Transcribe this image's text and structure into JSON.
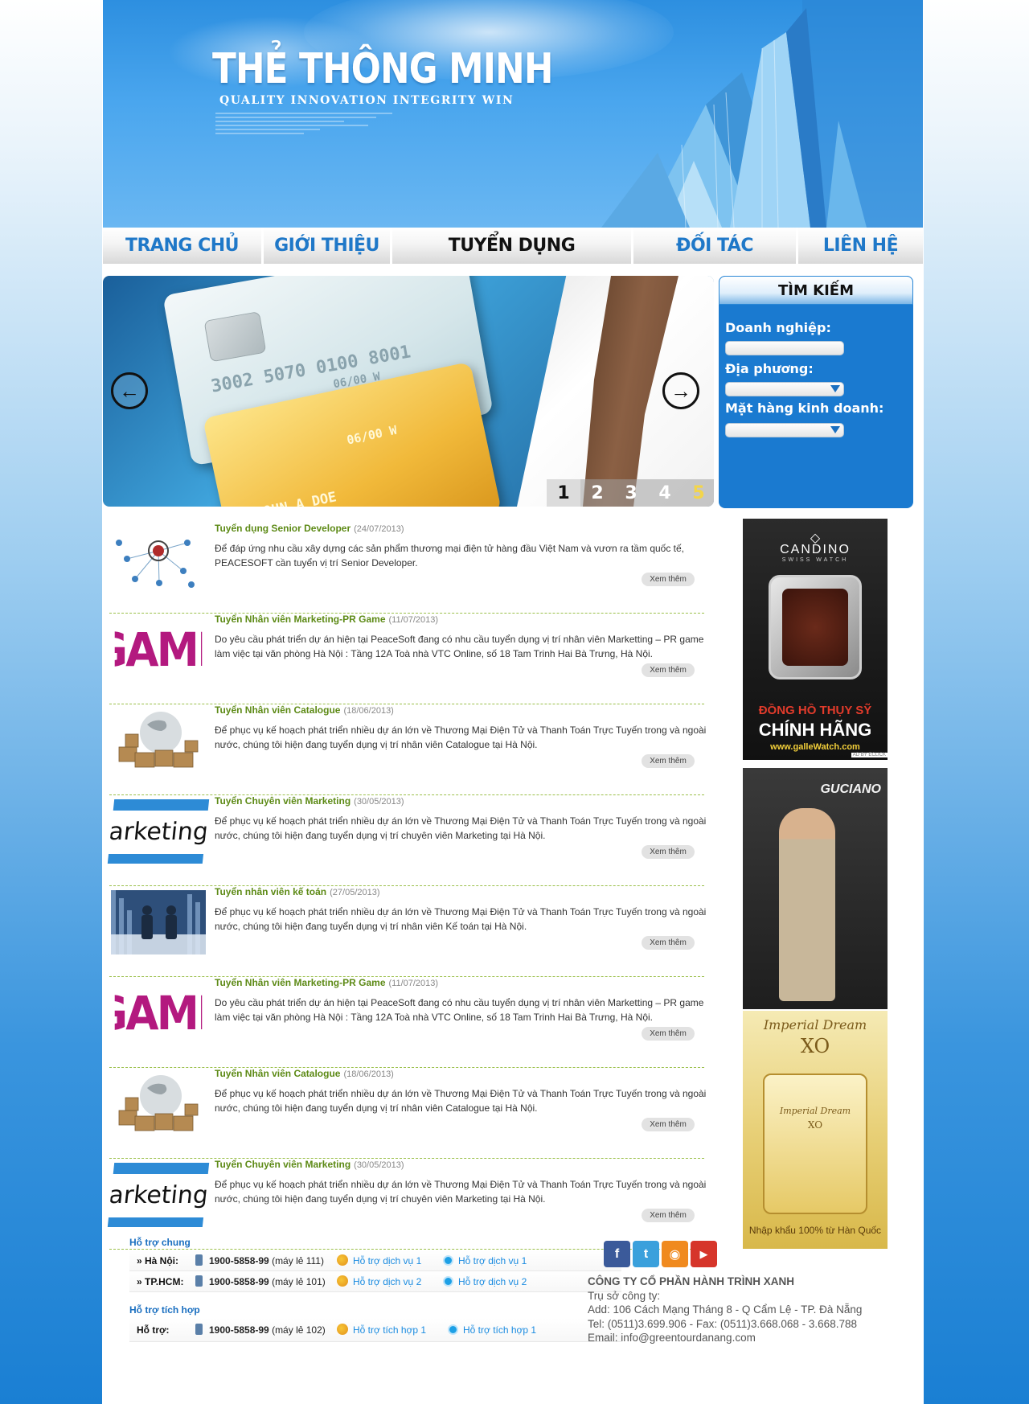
{
  "brand": {
    "title": "THẺ THÔNG MINH",
    "slogan": "QUALITY INNOVATION INTEGRITY WIN"
  },
  "menu": [
    {
      "label": "TRANG CHỦ",
      "active": false
    },
    {
      "label": "GIỚI THIỆU",
      "active": false
    },
    {
      "label": "TUYỂN DỤNG",
      "active": true
    },
    {
      "label": "ĐỐI TÁC",
      "active": false
    },
    {
      "label": "LIÊN HỆ",
      "active": false
    }
  ],
  "slider": {
    "card_number_1": "3002 5070 0100 8001",
    "card_valid_1": "06/00 W",
    "card_name_1": "JOHN A DOE",
    "card_valid_2": "06/00 W",
    "card_name_2": "JOHN A DOE",
    "pages": [
      "1",
      "2",
      "3",
      "4",
      "5"
    ],
    "current_page": "1"
  },
  "search": {
    "title": "TÌM KIẾM",
    "enterprise_label": "Doanh nghiệp:",
    "locality_label": "Địa phương:",
    "goods_label": "Mặt hàng kinh doanh:"
  },
  "jobs": [
    {
      "title": "Tuyển dụng Senior Developer",
      "date": "(24/07/2013)",
      "desc": "Để đáp ứng nhu cầu xây dựng các sản phẩm thương mại điện tử hàng đầu Việt Nam và vươn ra tầm quốc tế, PEACESOFT cần tuyển vị trí Senior Developer.",
      "more": "Xem thêm",
      "thumb": "network"
    },
    {
      "title": "Tuyển Nhân viên Marketing-PR Game",
      "date": "(11/07/2013)",
      "desc": "Do yêu cầu phát triển dự án hiện tại PeaceSoft đang có nhu cầu tuyển dụng vị trí nhân viên Marketting – PR game làm việc tại văn phòng Hà Nội : Tầng 12A Toà nhà VTC Online, số 18 Tam Trinh Hai Bà Trưng, Hà Nội.",
      "more": "Xem thêm",
      "thumb": "game",
      "thumb_text": "GAME"
    },
    {
      "title": "Tuyển Nhân viên Catalogue",
      "date": "(18/06/2013)",
      "desc": "Để phục vụ kế hoạch phát triển nhiều dự án lớn về Thương Mại Điện Tử và Thanh Toán Trực Tuyến trong và ngoài nước, chúng tôi hiện đang tuyển dụng vị trí nhân viên Catalogue tại Hà Nội.",
      "more": "Xem thêm",
      "thumb": "globe"
    },
    {
      "title": "Tuyển Chuyên viên Marketing",
      "date": "(30/05/2013)",
      "desc": "Để phục vụ kế hoạch phát triển nhiều dự án lớn về Thương Mại Điện Tử và Thanh Toán Trực Tuyến trong và ngoài nước, chúng tôi hiện đang tuyển dụng vị trí chuyên viên Marketing tại Hà Nội.",
      "more": "Xem thêm",
      "thumb": "marketing",
      "thumb_text": "marketing..."
    },
    {
      "title": "Tuyển nhân viên kế toán",
      "date": "(27/05/2013)",
      "desc": "Để phục vụ kế hoạch phát triển nhiều dự án lớn về Thương Mại Điện Tử và Thanh Toán Trực Tuyến trong và ngoài nước, chúng tôi hiện đang tuyển dụng vị trí nhân viên Kế toán tại Hà Nội.",
      "more": "Xem thêm",
      "thumb": "business"
    },
    {
      "title": "Tuyển Nhân viên Marketing-PR Game",
      "date": "(11/07/2013)",
      "desc": "Do yêu cầu phát triển dự án hiện tại PeaceSoft đang có nhu cầu tuyển dụng vị trí nhân viên Marketting – PR game làm việc tại văn phòng Hà Nội : Tầng 12A Toà nhà VTC Online, số 18 Tam Trinh Hai Bà Trưng, Hà Nội.",
      "more": "Xem thêm",
      "thumb": "game",
      "thumb_text": "GAME"
    },
    {
      "title": "Tuyển Nhân viên Catalogue",
      "date": "(18/06/2013)",
      "desc": "Để phục vụ kế hoạch phát triển nhiều dự án lớn về Thương Mại Điện Tử và Thanh Toán Trực Tuyến trong và ngoài nước, chúng tôi hiện đang tuyển dụng vị trí nhân viên Catalogue tại Hà Nội.",
      "more": "Xem thêm",
      "thumb": "globe"
    },
    {
      "title": "Tuyển Chuyên viên Marketing",
      "date": "(30/05/2013)",
      "desc": "Để phục vụ kế hoạch phát triển nhiều dự án lớn về Thương Mại Điện Tử và Thanh Toán Trực Tuyến trong và ngoài nước, chúng tôi hiện đang tuyển dụng vị trí chuyên viên Marketing tại Hà Nội.",
      "more": "Xem thêm",
      "thumb": "marketing",
      "thumb_text": "marketing..."
    }
  ],
  "ads": {
    "ad1": {
      "brand": "CANDINO",
      "sub": "SWISS WATCH",
      "line1": "ĐỒNG HỒ THỤY SỸ",
      "line2": "CHÍNH HÃNG",
      "url": "www.galleWatch.com",
      "credit": "AD BY ECLICK"
    },
    "ad2": {
      "brand": "GUCIANO"
    },
    "ad3": {
      "script": "Imperial Dream",
      "xo": "XO",
      "label_script": "Imperial Dream",
      "label_xo": "XO",
      "footer": "Nhập khẩu 100% từ Hàn Quốc"
    }
  },
  "support": {
    "general_title": "Hỗ trợ chung",
    "rows": [
      {
        "place": "» Hà Nội:",
        "phone": "1900-5858-99",
        "ext": " (máy lẻ 111)",
        "link1": "Hỗ trợ dịch vụ 1",
        "link2": "Hỗ trợ dịch vụ 1"
      },
      {
        "place": "» TP.HCM:",
        "phone": "1900-5858-99",
        "ext": " (máy lẻ 101)",
        "link1": "Hỗ trợ dịch vụ 2",
        "link2": "Hỗ trợ dịch vụ 2"
      }
    ],
    "integrated_title": "Hỗ trợ tích hợp",
    "integrated": {
      "place": "Hỗ trợ:",
      "phone": "1900-5858-99",
      "ext": " (máy lẻ 102)",
      "link1": "Hỗ trợ tích hợp 1",
      "link2": "Hỗ trợ tích hợp 1"
    }
  },
  "social": [
    {
      "icon": "facebook-icon",
      "glyph": "f",
      "color": "#3b5a9a"
    },
    {
      "icon": "twitter-icon",
      "glyph": "t",
      "color": "#3aa0dc"
    },
    {
      "icon": "rss-icon",
      "glyph": "◉",
      "color": "#f08a1f"
    },
    {
      "icon": "youtube-icon",
      "glyph": "▶",
      "color": "#d6352a"
    }
  ],
  "company": {
    "name": "CÔNG TY CỔ PHẦN HÀNH TRÌNH XANH",
    "hq": "Trụ sở công ty:",
    "addr": "Add: 106 Cách Mạng Tháng 8 - Q Cẩm Lệ - TP. Đà Nẵng",
    "tel": "Tel: (0511)3.699.906 - Fax: (0511)3.668.068 - 3.668.788",
    "email": "Email: info@greentourdanang.com"
  }
}
